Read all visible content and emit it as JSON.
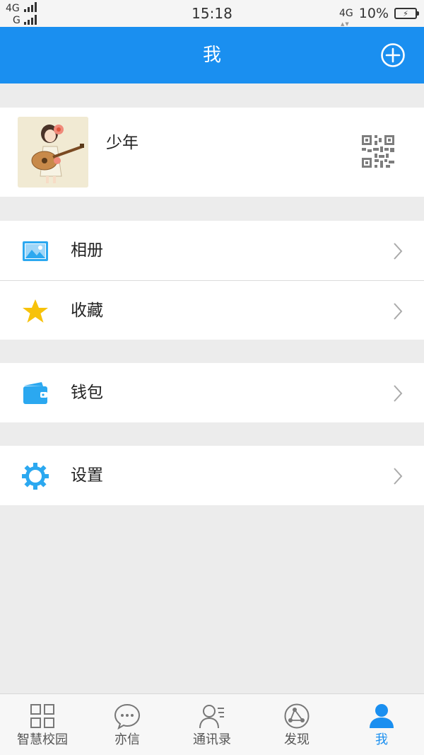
{
  "status_bar": {
    "network_1": "4G",
    "network_2": "G",
    "time": "15:18",
    "network_right": "4G",
    "battery_percent": "10%"
  },
  "header": {
    "title": "我",
    "add_icon": "plus-circle-icon"
  },
  "profile": {
    "name": "少年",
    "avatar_icon": "girl-with-guitar-avatar",
    "qr_icon": "qr-code-icon"
  },
  "menu": {
    "album": {
      "label": "相册",
      "icon": "picture-icon",
      "color": "#2ba8f0"
    },
    "favorites": {
      "label": "收藏",
      "icon": "star-icon",
      "color": "#f7c20a"
    },
    "wallet": {
      "label": "钱包",
      "icon": "wallet-icon",
      "color": "#2ba8f0"
    },
    "settings": {
      "label": "设置",
      "icon": "gear-icon",
      "color": "#2ba8f0"
    }
  },
  "bottom_nav": {
    "items": [
      {
        "label": "智慧校园",
        "icon": "grid-icon",
        "active": false
      },
      {
        "label": "亦信",
        "icon": "chat-bubble-icon",
        "active": false
      },
      {
        "label": "通讯录",
        "icon": "contacts-icon",
        "active": false
      },
      {
        "label": "发现",
        "icon": "discover-icon",
        "active": false
      },
      {
        "label": "我",
        "icon": "person-icon",
        "active": true
      }
    ]
  },
  "colors": {
    "accent": "#1a8ff0",
    "background": "#ececec",
    "star": "#f7c20a"
  }
}
